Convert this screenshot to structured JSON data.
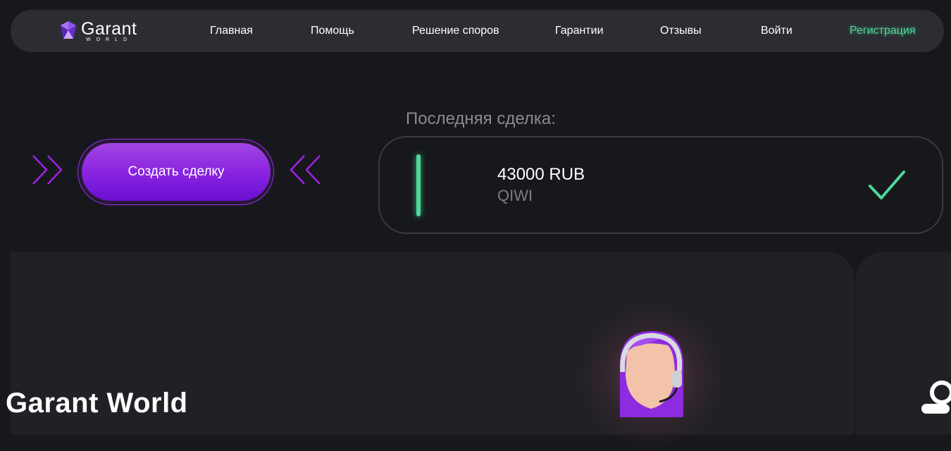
{
  "brand": {
    "name": "Garant",
    "sub": "WORLD"
  },
  "nav": {
    "items": [
      {
        "label": "Главная"
      },
      {
        "label": "Помощь"
      },
      {
        "label": "Решение споров"
      },
      {
        "label": "Гарантии"
      },
      {
        "label": "Отзывы"
      },
      {
        "label": "Войти"
      },
      {
        "label": "Регистрация"
      }
    ]
  },
  "cta": {
    "label": "Создать сделку"
  },
  "last_deal": {
    "title": "Последняя сделка:",
    "amount": "43000 RUB",
    "method": "QIWI",
    "status_icon": "check-icon"
  },
  "section": {
    "heading": "Garant World"
  },
  "colors": {
    "background": "#17181c",
    "nav_bg": "#2c2d33",
    "accent_purple": "#8a24e0",
    "accent_green": "#4ed89a",
    "panel_bg": "#202125"
  }
}
